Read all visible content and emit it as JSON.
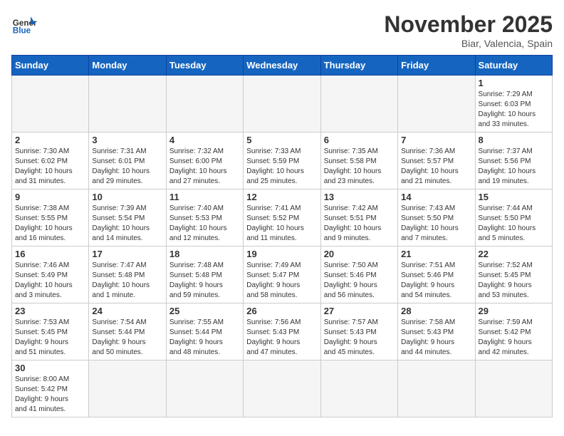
{
  "header": {
    "logo_general": "General",
    "logo_blue": "Blue",
    "month": "November 2025",
    "location": "Biar, Valencia, Spain"
  },
  "weekdays": [
    "Sunday",
    "Monday",
    "Tuesday",
    "Wednesday",
    "Thursday",
    "Friday",
    "Saturday"
  ],
  "weeks": [
    [
      {
        "day": "",
        "info": ""
      },
      {
        "day": "",
        "info": ""
      },
      {
        "day": "",
        "info": ""
      },
      {
        "day": "",
        "info": ""
      },
      {
        "day": "",
        "info": ""
      },
      {
        "day": "",
        "info": ""
      },
      {
        "day": "1",
        "info": "Sunrise: 7:29 AM\nSunset: 6:03 PM\nDaylight: 10 hours\nand 33 minutes."
      }
    ],
    [
      {
        "day": "2",
        "info": "Sunrise: 7:30 AM\nSunset: 6:02 PM\nDaylight: 10 hours\nand 31 minutes."
      },
      {
        "day": "3",
        "info": "Sunrise: 7:31 AM\nSunset: 6:01 PM\nDaylight: 10 hours\nand 29 minutes."
      },
      {
        "day": "4",
        "info": "Sunrise: 7:32 AM\nSunset: 6:00 PM\nDaylight: 10 hours\nand 27 minutes."
      },
      {
        "day": "5",
        "info": "Sunrise: 7:33 AM\nSunset: 5:59 PM\nDaylight: 10 hours\nand 25 minutes."
      },
      {
        "day": "6",
        "info": "Sunrise: 7:35 AM\nSunset: 5:58 PM\nDaylight: 10 hours\nand 23 minutes."
      },
      {
        "day": "7",
        "info": "Sunrise: 7:36 AM\nSunset: 5:57 PM\nDaylight: 10 hours\nand 21 minutes."
      },
      {
        "day": "8",
        "info": "Sunrise: 7:37 AM\nSunset: 5:56 PM\nDaylight: 10 hours\nand 19 minutes."
      }
    ],
    [
      {
        "day": "9",
        "info": "Sunrise: 7:38 AM\nSunset: 5:55 PM\nDaylight: 10 hours\nand 16 minutes."
      },
      {
        "day": "10",
        "info": "Sunrise: 7:39 AM\nSunset: 5:54 PM\nDaylight: 10 hours\nand 14 minutes."
      },
      {
        "day": "11",
        "info": "Sunrise: 7:40 AM\nSunset: 5:53 PM\nDaylight: 10 hours\nand 12 minutes."
      },
      {
        "day": "12",
        "info": "Sunrise: 7:41 AM\nSunset: 5:52 PM\nDaylight: 10 hours\nand 11 minutes."
      },
      {
        "day": "13",
        "info": "Sunrise: 7:42 AM\nSunset: 5:51 PM\nDaylight: 10 hours\nand 9 minutes."
      },
      {
        "day": "14",
        "info": "Sunrise: 7:43 AM\nSunset: 5:50 PM\nDaylight: 10 hours\nand 7 minutes."
      },
      {
        "day": "15",
        "info": "Sunrise: 7:44 AM\nSunset: 5:50 PM\nDaylight: 10 hours\nand 5 minutes."
      }
    ],
    [
      {
        "day": "16",
        "info": "Sunrise: 7:46 AM\nSunset: 5:49 PM\nDaylight: 10 hours\nand 3 minutes."
      },
      {
        "day": "17",
        "info": "Sunrise: 7:47 AM\nSunset: 5:48 PM\nDaylight: 10 hours\nand 1 minute."
      },
      {
        "day": "18",
        "info": "Sunrise: 7:48 AM\nSunset: 5:48 PM\nDaylight: 9 hours\nand 59 minutes."
      },
      {
        "day": "19",
        "info": "Sunrise: 7:49 AM\nSunset: 5:47 PM\nDaylight: 9 hours\nand 58 minutes."
      },
      {
        "day": "20",
        "info": "Sunrise: 7:50 AM\nSunset: 5:46 PM\nDaylight: 9 hours\nand 56 minutes."
      },
      {
        "day": "21",
        "info": "Sunrise: 7:51 AM\nSunset: 5:46 PM\nDaylight: 9 hours\nand 54 minutes."
      },
      {
        "day": "22",
        "info": "Sunrise: 7:52 AM\nSunset: 5:45 PM\nDaylight: 9 hours\nand 53 minutes."
      }
    ],
    [
      {
        "day": "23",
        "info": "Sunrise: 7:53 AM\nSunset: 5:45 PM\nDaylight: 9 hours\nand 51 minutes."
      },
      {
        "day": "24",
        "info": "Sunrise: 7:54 AM\nSunset: 5:44 PM\nDaylight: 9 hours\nand 50 minutes."
      },
      {
        "day": "25",
        "info": "Sunrise: 7:55 AM\nSunset: 5:44 PM\nDaylight: 9 hours\nand 48 minutes."
      },
      {
        "day": "26",
        "info": "Sunrise: 7:56 AM\nSunset: 5:43 PM\nDaylight: 9 hours\nand 47 minutes."
      },
      {
        "day": "27",
        "info": "Sunrise: 7:57 AM\nSunset: 5:43 PM\nDaylight: 9 hours\nand 45 minutes."
      },
      {
        "day": "28",
        "info": "Sunrise: 7:58 AM\nSunset: 5:43 PM\nDaylight: 9 hours\nand 44 minutes."
      },
      {
        "day": "29",
        "info": "Sunrise: 7:59 AM\nSunset: 5:42 PM\nDaylight: 9 hours\nand 42 minutes."
      }
    ],
    [
      {
        "day": "30",
        "info": "Sunrise: 8:00 AM\nSunset: 5:42 PM\nDaylight: 9 hours\nand 41 minutes."
      },
      {
        "day": "",
        "info": ""
      },
      {
        "day": "",
        "info": ""
      },
      {
        "day": "",
        "info": ""
      },
      {
        "day": "",
        "info": ""
      },
      {
        "day": "",
        "info": ""
      },
      {
        "day": "",
        "info": ""
      }
    ]
  ]
}
